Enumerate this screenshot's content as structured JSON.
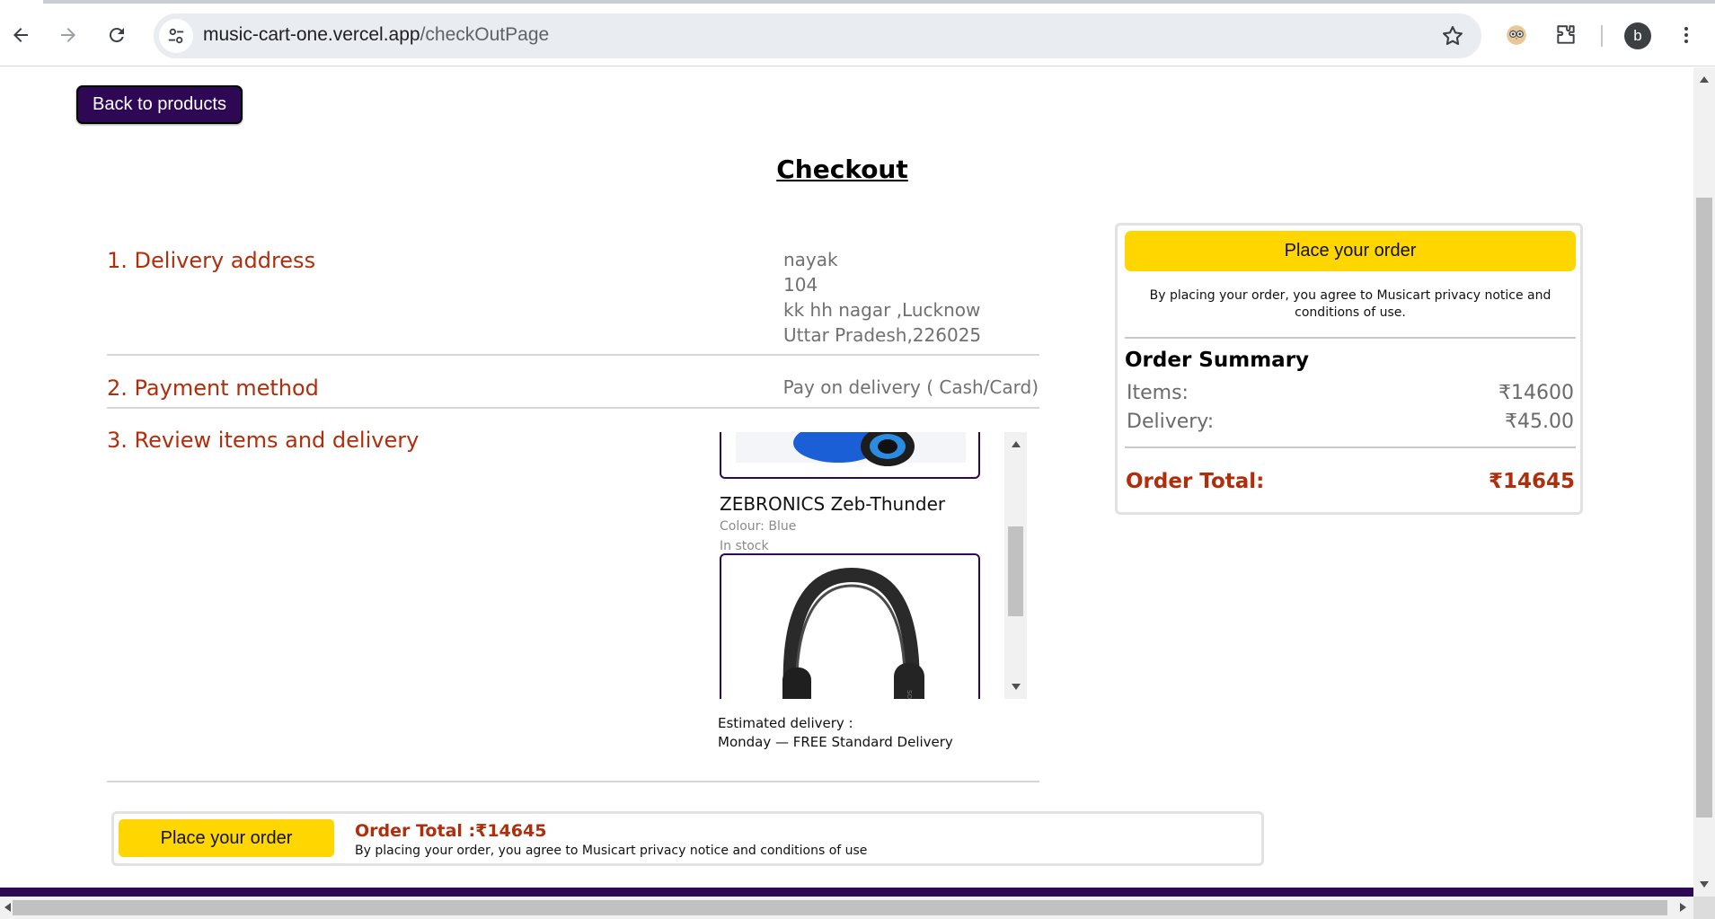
{
  "browser": {
    "url_host": "music-cart-one.vercel.app",
    "url_path": "/checkOutPage",
    "profile_initial": "b"
  },
  "page": {
    "back_button": "Back to products",
    "title": "Checkout",
    "delivery": {
      "heading": "1. Delivery address",
      "name": "nayak",
      "line1": "104",
      "line2": "kk hh nagar ,Lucknow",
      "line3": "Uttar Pradesh,226025"
    },
    "payment": {
      "heading": "2. Payment method",
      "method": "Pay on delivery ( Cash/Card)"
    },
    "review": {
      "heading": "3. Review items and delivery",
      "item": {
        "name": "ZEBRONICS Zeb-Thunder",
        "colour": "Colour: Blue",
        "stock": "In stock"
      },
      "estimated_label": "Estimated delivery :",
      "estimated_value": "Monday — FREE Standard Delivery"
    },
    "summary": {
      "place_order": "Place your order",
      "agree_text": "By placing your order, you agree to Musicart privacy notice and conditions of use.",
      "title": "Order Summary",
      "items_label": "Items:",
      "items_value": "₹14600",
      "delivery_label": "Delivery:",
      "delivery_value": "₹45.00",
      "total_label": "Order Total:",
      "total_value": "₹14645"
    },
    "bottom_bar": {
      "place_order": "Place your order",
      "total": "Order Total :₹14645",
      "agree_text": "By placing your order, you agree to Musicart privacy notice and conditions of use"
    }
  },
  "colors": {
    "brand_purple": "#2e0854",
    "accent_red": "#b02e0c",
    "button_yellow": "#ffd600"
  }
}
